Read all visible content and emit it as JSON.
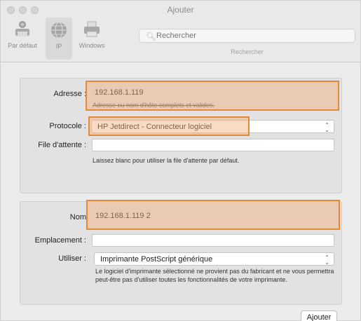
{
  "window": {
    "title": "Ajouter"
  },
  "toolbar": {
    "items": [
      {
        "label": "Par défaut",
        "icon": "default-printer-icon"
      },
      {
        "label": "IP",
        "icon": "ip-globe-icon"
      },
      {
        "label": "Windows",
        "icon": "windows-printer-icon"
      }
    ],
    "search": {
      "placeholder": "Rechercher",
      "caption": "Rechercher"
    }
  },
  "form": {
    "address": {
      "label": "Adresse :",
      "value": "192.168.1.119",
      "hint": "Adresse ou nom d'hôte complets et valides."
    },
    "protocol": {
      "label": "Protocole :",
      "value": "HP Jetdirect - Connecteur logiciel"
    },
    "queue": {
      "label": "File d'attente :",
      "value": "",
      "hint": "Laissez blanc pour utiliser la file d'attente par défaut."
    },
    "name": {
      "label": "Nom",
      "value": "192.168.1.119 2"
    },
    "location": {
      "label": "Emplacement :",
      "value": ""
    },
    "use": {
      "label": "Utiliser :",
      "value": "Imprimante PostScript générique",
      "hint": "Le logiciel d'imprimante sélectionné ne provient pas du fabricant et ne vous permettra peut-être pas d'utiliser toutes les fonctionnalités de votre imprimante."
    }
  },
  "actions": {
    "add_label": "Ajouter"
  },
  "colors": {
    "highlight_border": "#e58a34",
    "highlight_fill": "#f4ac78"
  }
}
